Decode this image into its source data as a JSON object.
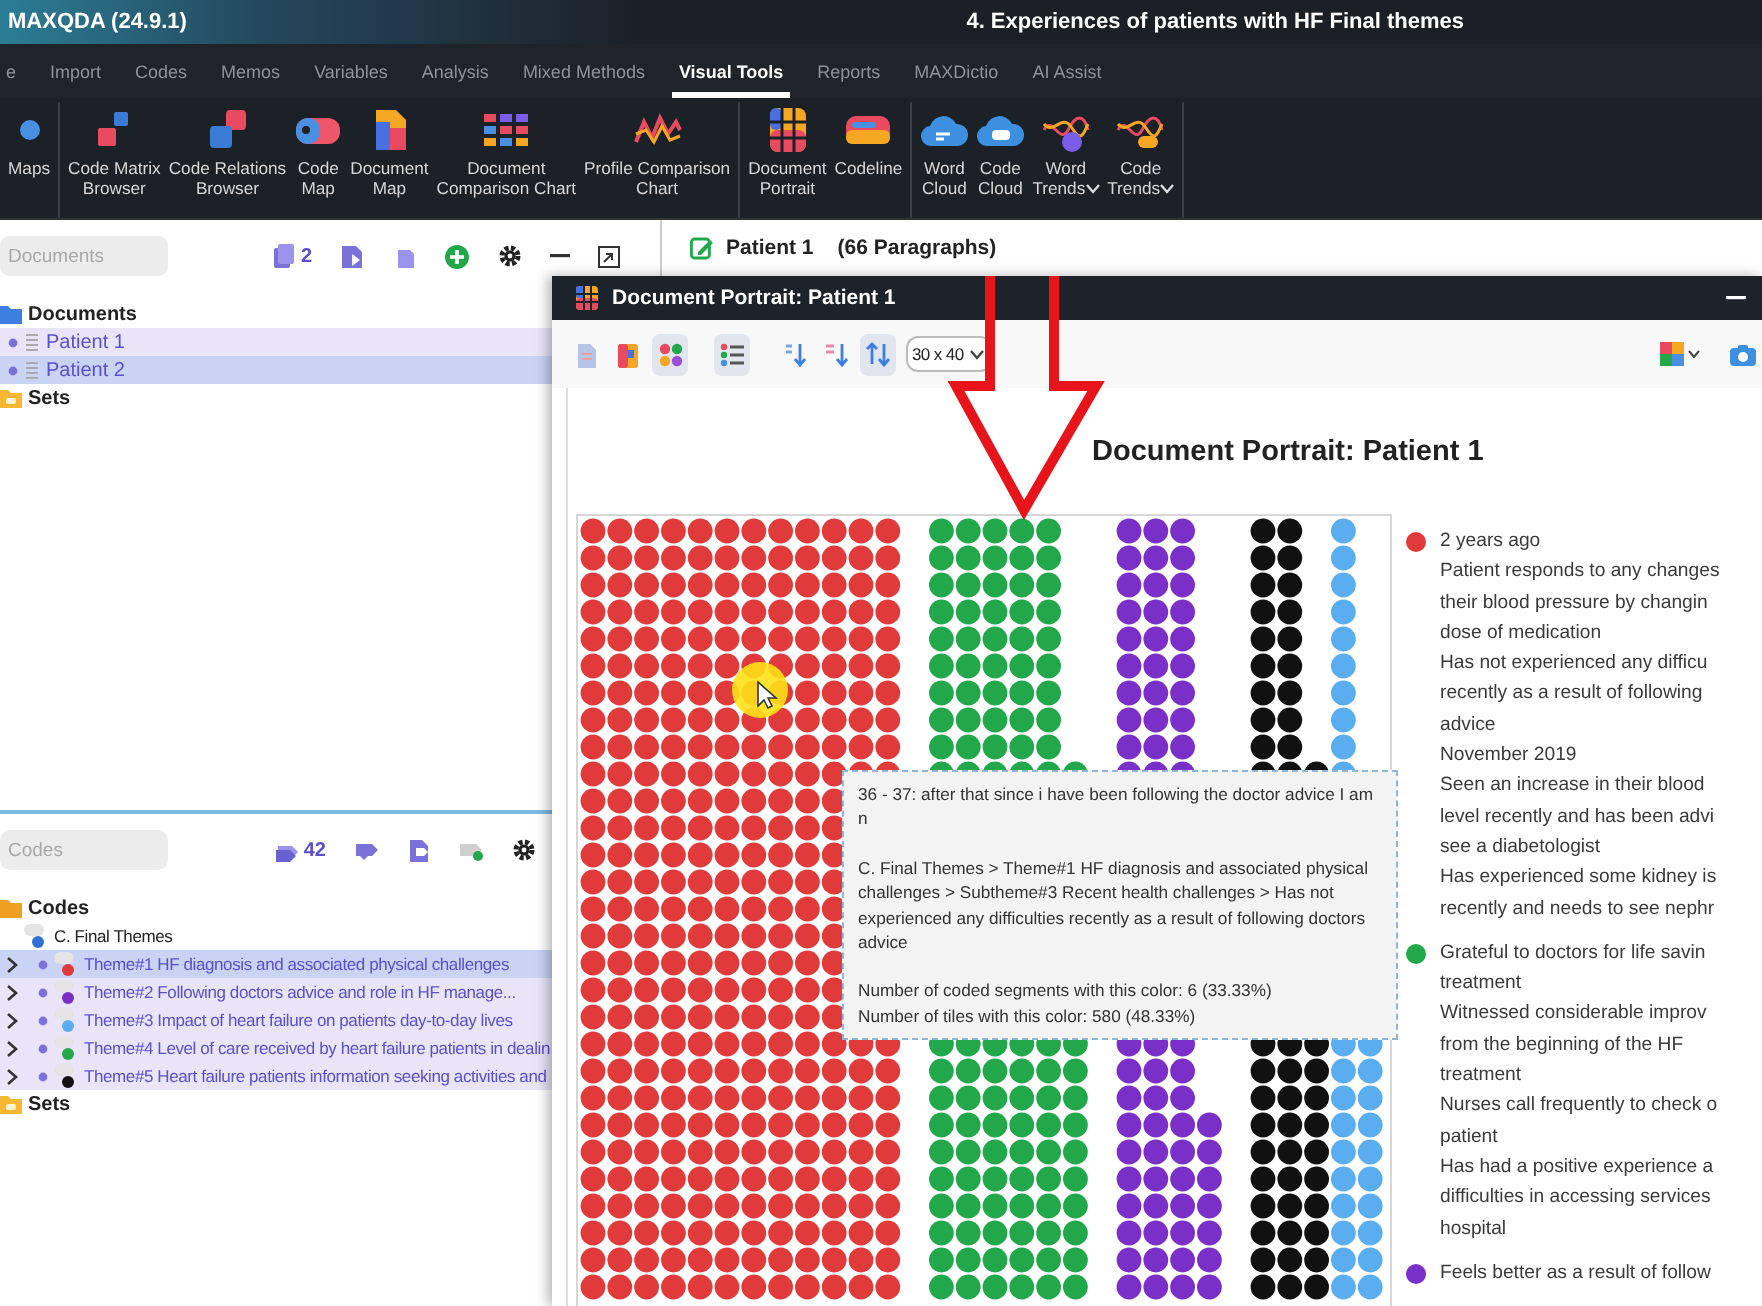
{
  "app": {
    "title": "MAXQDA (24.9.1)",
    "project": "4. Experiences of patients with HF Final themes"
  },
  "menu_tabs": [
    {
      "label": "e",
      "selected": false
    },
    {
      "label": "Import",
      "selected": false
    },
    {
      "label": "Codes",
      "selected": false
    },
    {
      "label": "Memos",
      "selected": false
    },
    {
      "label": "Variables",
      "selected": false
    },
    {
      "label": "Analysis",
      "selected": false
    },
    {
      "label": "Mixed Methods",
      "selected": false
    },
    {
      "label": "Visual Tools",
      "selected": true
    },
    {
      "label": "Reports",
      "selected": false
    },
    {
      "label": "MAXDictio",
      "selected": false
    },
    {
      "label": "AI Assist",
      "selected": false
    }
  ],
  "ribbon": {
    "groups": [
      {
        "items": [
          {
            "label": "Maps",
            "dropdown": false
          }
        ]
      },
      {
        "items": [
          {
            "label": "Code Matrix\nBrowser",
            "dropdown": false
          },
          {
            "label": "Code Relations\nBrowser",
            "dropdown": false
          },
          {
            "label": "Code\nMap",
            "dropdown": false
          },
          {
            "label": "Document\nMap",
            "dropdown": false
          },
          {
            "label": "Document\nComparison Chart",
            "dropdown": false
          },
          {
            "label": "Profile Comparison\nChart",
            "dropdown": false
          }
        ]
      },
      {
        "items": [
          {
            "label": "Document\nPortrait",
            "dropdown": false
          },
          {
            "label": "Codeline",
            "dropdown": false
          }
        ]
      },
      {
        "items": [
          {
            "label": "Word\nCloud",
            "dropdown": false
          },
          {
            "label": "Code\nCloud",
            "dropdown": false
          },
          {
            "label": "Word\nTrends",
            "dropdown": true
          },
          {
            "label": "Code\nTrends",
            "dropdown": true
          }
        ]
      }
    ]
  },
  "documents_panel": {
    "search": {
      "placeholder": "Documents"
    },
    "count": "2",
    "tree": [
      {
        "label": "Documents",
        "kind": "document-folder",
        "children": [
          {
            "label": "Patient 1",
            "kind": "document",
            "activated": true,
            "selected": false
          },
          {
            "label": "Patient 2",
            "kind": "document",
            "activated": true,
            "selected": true
          }
        ]
      },
      {
        "label": "Sets",
        "kind": "set-folder"
      }
    ]
  },
  "codes_panel": {
    "search": {
      "placeholder": "Codes"
    },
    "count": "42",
    "tree": [
      {
        "label": "Codes",
        "kind": "code-folder",
        "children": [
          {
            "label": "C. Final Themes",
            "kind": "code",
            "color": "#2f6fd6",
            "children": [
              {
                "label": "Theme#1 HF diagnosis and associated physical challenges",
                "kind": "code",
                "color": "#e03a3a",
                "expanded": false,
                "activated": true,
                "selected": true
              },
              {
                "label": "Theme#2 Following doctors advice and role in HF manage...",
                "kind": "code",
                "color": "#7b2fc9",
                "expanded": false,
                "activated": true,
                "selected": false
              },
              {
                "label": "Theme#3 Impact of heart failure on patients day-to-day lives",
                "kind": "code",
                "color": "#5aaef0",
                "expanded": false,
                "activated": true,
                "selected": false
              },
              {
                "label": "Theme#4 Level of care received  by heart failure patients in  dealin",
                "kind": "code",
                "color": "#22a84a",
                "expanded": false,
                "activated": true,
                "selected": false
              },
              {
                "label": "Theme#5 Heart failure patients information seeking activities and",
                "kind": "code",
                "color": "#111111",
                "expanded": false,
                "activated": true,
                "selected": false
              }
            ]
          }
        ]
      },
      {
        "label": "Sets",
        "kind": "set-folder"
      }
    ]
  },
  "document_header": {
    "document": "Patient 1",
    "paragraphs": "(66 Paragraphs)"
  },
  "portrait_window": {
    "title": "Document Portrait: Patient 1",
    "toolbar_buttons": [
      {
        "selected": false
      },
      {
        "selected": false
      },
      {
        "selected": true
      },
      {
        "selected": true
      },
      {
        "selected": false
      },
      {
        "selected": false
      },
      {
        "selected": true
      }
    ],
    "grid_size": "30 x 40",
    "heading": "Document Portrait: Patient 1",
    "legend": [
      {
        "color": "#e03a3a",
        "lines": [
          "2 years ago",
          "Patient responds to any changes",
          "their blood pressure by changin",
          "dose of medication",
          "Has not experienced any difficu",
          "recently as a result of following",
          "advice",
          "November 2019",
          "Seen an increase in their blood",
          "level recently and has been advi",
          "see a diabetologist",
          "Has experienced some kidney is",
          "recently and needs to see nephr"
        ]
      },
      {
        "color": "#22a84a",
        "lines": [
          "Grateful to doctors for life savin",
          "treatment",
          "Witnessed considerable improv",
          "from the beginning of the HF",
          "treatment",
          "Nurses call frequently to check o",
          "patient",
          "Has had a positive experience a",
          "difficulties in accessing services",
          "hospital"
        ]
      },
      {
        "color": "#7b2fc9",
        "lines": [
          "Feels better as a result of follow"
        ]
      }
    ],
    "tooltip": {
      "segment": "36 - 37: after that since i have been following the doctor advice I am n",
      "path": "C. Final Themes > Theme#1 HF diagnosis and associated physical challenges > Subtheme#3 Recent health challenges > Has not experienced any difficulties recently as a result of following doctors advice",
      "segments_count": "Number of coded segments with this color: 6 (33.33%)",
      "tiles_count": "Number of tiles with this color: 580 (48.33%)"
    }
  }
}
